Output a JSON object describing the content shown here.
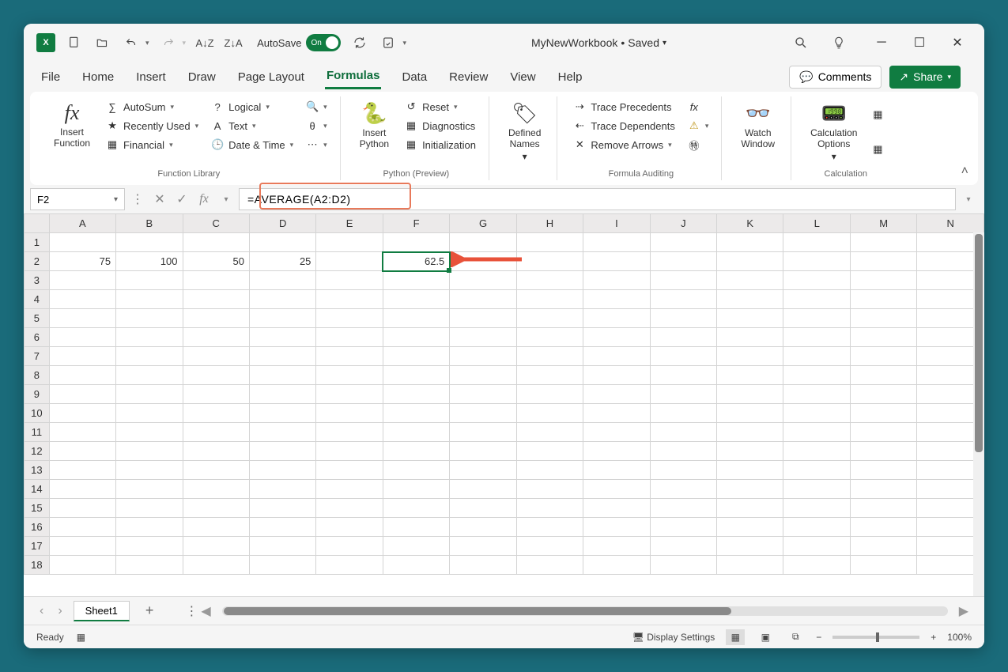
{
  "titlebar": {
    "autosave_label": "AutoSave",
    "autosave_state": "On",
    "workbook_name": "MyNewWorkbook",
    "save_state": "Saved"
  },
  "tabs": {
    "file": "File",
    "home": "Home",
    "insert": "Insert",
    "draw": "Draw",
    "page_layout": "Page Layout",
    "formulas": "Formulas",
    "data": "Data",
    "review": "Review",
    "view": "View",
    "help": "Help",
    "comments": "Comments",
    "share": "Share"
  },
  "ribbon": {
    "insert_function": "Insert\nFunction",
    "autosum": "AutoSum",
    "recently_used": "Recently Used",
    "financial": "Financial",
    "logical": "Logical",
    "text": "Text",
    "date_time": "Date & Time",
    "function_library": "Function Library",
    "insert_python": "Insert\nPython",
    "reset": "Reset",
    "diagnostics": "Diagnostics",
    "initialization": "Initialization",
    "python_preview": "Python (Preview)",
    "defined_names": "Defined\nNames",
    "trace_precedents": "Trace Precedents",
    "trace_dependents": "Trace Dependents",
    "remove_arrows": "Remove Arrows",
    "formula_auditing": "Formula Auditing",
    "watch_window": "Watch\nWindow",
    "calculation_options": "Calculation\nOptions",
    "calculation": "Calculation"
  },
  "formula_bar": {
    "name_box": "F2",
    "formula": "=AVERAGE(A2:D2)"
  },
  "grid": {
    "columns": [
      "A",
      "B",
      "C",
      "D",
      "E",
      "F",
      "G",
      "H",
      "I",
      "J",
      "K",
      "L",
      "M",
      "N"
    ],
    "row_count": 18,
    "cells": {
      "A2": "75",
      "B2": "100",
      "C2": "50",
      "D2": "25",
      "F2": "62.5"
    },
    "selected_cell": "F2"
  },
  "sheet_tabs": {
    "active": "Sheet1"
  },
  "statusbar": {
    "ready": "Ready",
    "display_settings": "Display Settings",
    "zoom": "100%"
  }
}
